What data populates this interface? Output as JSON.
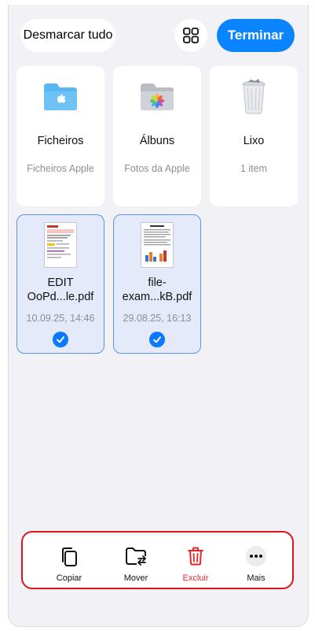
{
  "header": {
    "deselect_label": "Desmarcar tudo",
    "done_label": "Terminar"
  },
  "locations": [
    {
      "name": "Ficheiros",
      "sub": "Ficheiros Apple",
      "icon": "blue-folder-icon"
    },
    {
      "name": "Álbuns",
      "sub": "Fotos da Apple",
      "icon": "photos-folder-icon"
    },
    {
      "name": "Lixo",
      "sub": "1 item",
      "icon": "trash-bin-icon"
    }
  ],
  "files": [
    {
      "name_line1": "EDIT",
      "name_line2": "OoPd...le.pdf",
      "date": "10.09.25, 14:46",
      "selected": true
    },
    {
      "name_line1": "file-",
      "name_line2": "exam...kB.pdf",
      "date": "29.08.25, 16:13",
      "selected": true
    }
  ],
  "toolbar": {
    "copy_label": "Copiar",
    "move_label": "Mover",
    "delete_label": "Excluir",
    "more_label": "Mais"
  },
  "colors": {
    "accent": "#0a84ff",
    "delete": "#e5262c",
    "highlight_border": "#e0141b"
  }
}
